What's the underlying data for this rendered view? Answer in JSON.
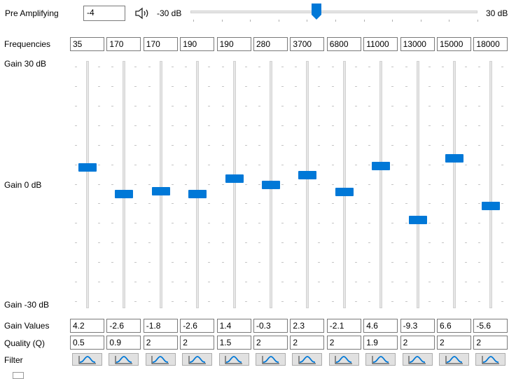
{
  "preamp": {
    "label": "Pre Amplifying",
    "value": "-4",
    "min_label": "-30 dB",
    "max_label": "30 dB",
    "level_db": -4,
    "range_db": [
      -30,
      30
    ],
    "icon": "speaker-icon"
  },
  "bands": {
    "frequencies_label": "Frequencies",
    "gain_max_label": "Gain 30 dB",
    "gain_zero_label": "Gain 0 dB",
    "gain_min_label": "Gain -30 dB",
    "gain_values_label": "Gain Values",
    "quality_label": "Quality (Q)",
    "filter_label": "Filter",
    "frequencies": [
      "35",
      "170",
      "170",
      "190",
      "190",
      "280",
      "3700",
      "6800",
      "11000",
      "13000",
      "15000",
      "18000"
    ],
    "gains": [
      "4.2",
      "-2.6",
      "-1.8",
      "-2.6",
      "1.4",
      "-0.3",
      "2.3",
      "-2.1",
      "4.6",
      "-9.3",
      "6.6",
      "-5.6"
    ],
    "qualities": [
      "0.5",
      "0.9",
      "2",
      "2",
      "1.5",
      "2",
      "2",
      "2",
      "1.9",
      "2",
      "2",
      "2"
    ],
    "filter_icon": "peak-filter-icon",
    "accent_color": "#0078d7"
  }
}
